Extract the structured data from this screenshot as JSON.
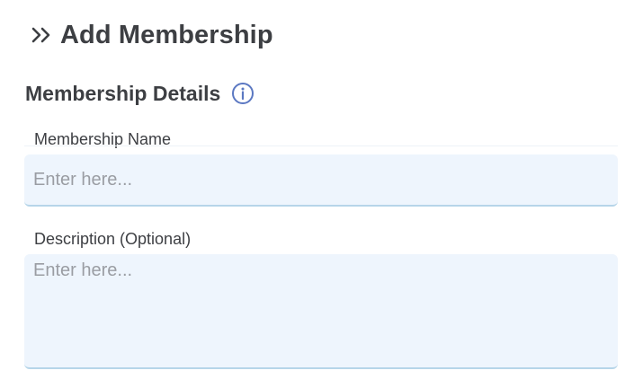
{
  "header": {
    "title": "Add Membership",
    "icon": "double-chevron-right-icon"
  },
  "section": {
    "title": "Membership Details",
    "info_icon": "info-icon",
    "accent": "#5b78c2"
  },
  "form": {
    "name_label": "Membership Name",
    "name_placeholder": "Enter here...",
    "name_value": "",
    "description_label": "Description (Optional)",
    "description_placeholder": "Enter here...",
    "description_value": ""
  },
  "colors": {
    "text": "#3d3f43",
    "input_bg": "#eef5fd",
    "input_border": "#b6d5e9",
    "placeholder": "#9a9da3"
  }
}
